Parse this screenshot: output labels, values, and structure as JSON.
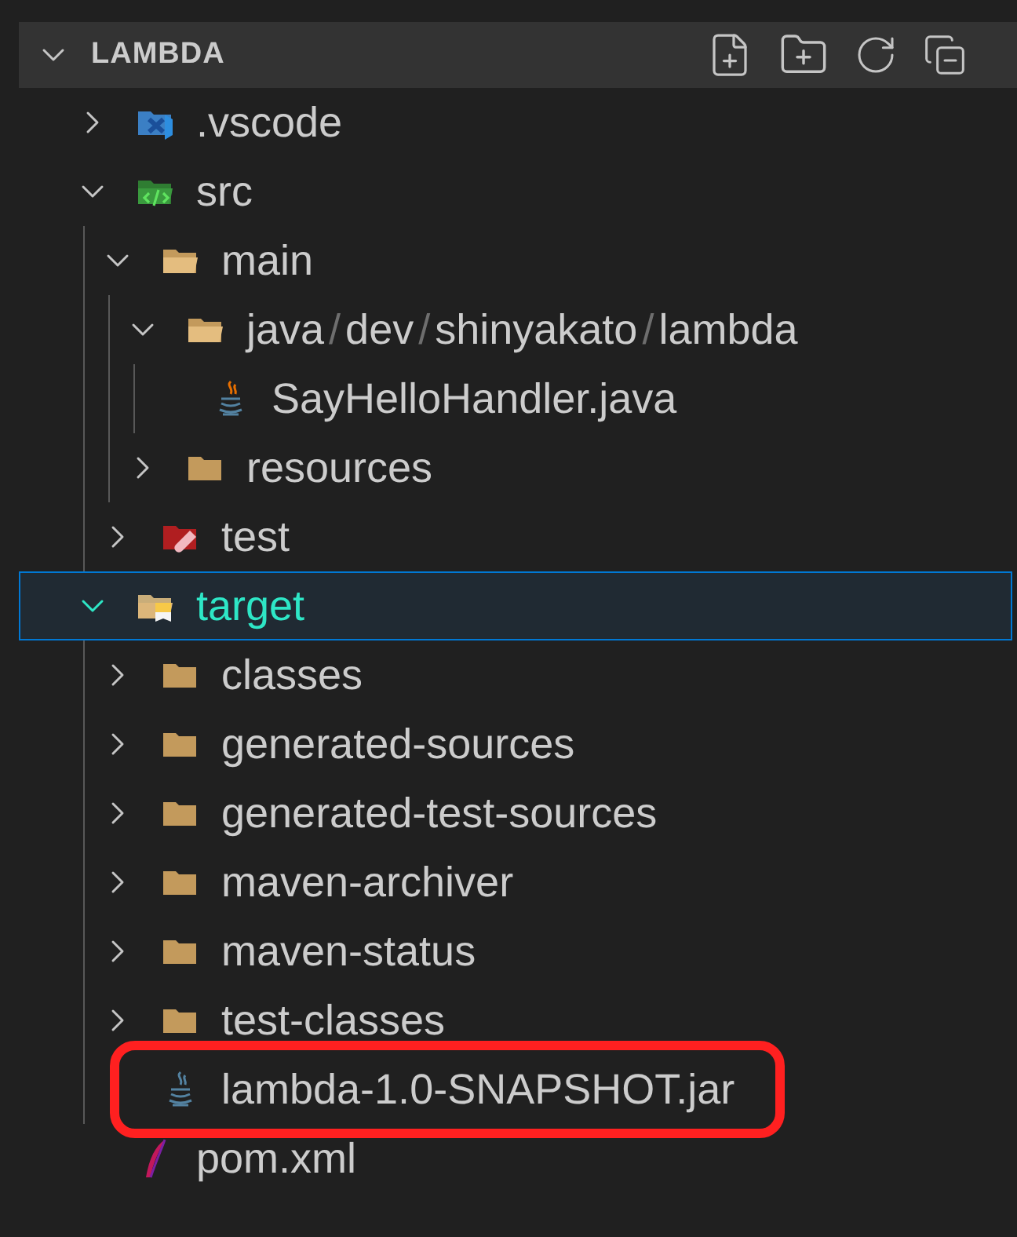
{
  "section": {
    "title": "LAMBDA",
    "expanded": true
  },
  "tree": [
    {
      "name": ".vscode",
      "kind": "vscode",
      "expanded": false,
      "selected": false,
      "highlighted": false
    },
    {
      "name": "src",
      "kind": "source",
      "expanded": true,
      "selected": false,
      "highlighted": false,
      "children": [
        {
          "name": "main",
          "kind": "folder",
          "expanded": true,
          "selected": false,
          "highlighted": false,
          "children": [
            {
              "segments": [
                "java",
                "dev",
                "shinyakato",
                "lambda"
              ],
              "separator": "/",
              "kind": "folder",
              "expanded": true,
              "selected": false,
              "highlighted": false,
              "children": [
                {
                  "name": "SayHelloHandler.java",
                  "kind": "java",
                  "selected": false,
                  "highlighted": false
                }
              ]
            },
            {
              "name": "resources",
              "kind": "folder",
              "expanded": false,
              "selected": false,
              "highlighted": false
            }
          ]
        },
        {
          "name": "test",
          "kind": "tests",
          "expanded": false,
          "selected": false,
          "highlighted": false
        }
      ]
    },
    {
      "name": "target",
      "kind": "target",
      "expanded": true,
      "selected": true,
      "highlighted": false,
      "children": [
        {
          "name": "classes",
          "kind": "folder",
          "expanded": false,
          "selected": false,
          "highlighted": false
        },
        {
          "name": "generated-sources",
          "kind": "folder",
          "expanded": false,
          "selected": false,
          "highlighted": false
        },
        {
          "name": "generated-test-sources",
          "kind": "folder",
          "expanded": false,
          "selected": false,
          "highlighted": false
        },
        {
          "name": "maven-archiver",
          "kind": "folder",
          "expanded": false,
          "selected": false,
          "highlighted": false
        },
        {
          "name": "maven-status",
          "kind": "folder",
          "expanded": false,
          "selected": false,
          "highlighted": false
        },
        {
          "name": "test-classes",
          "kind": "folder",
          "expanded": false,
          "selected": false,
          "highlighted": false
        },
        {
          "name": "lambda-1.0-SNAPSHOT.jar",
          "kind": "jar",
          "selected": false,
          "highlighted": true
        }
      ]
    },
    {
      "name": "pom.xml",
      "kind": "maven",
      "selected": false,
      "highlighted": false
    }
  ]
}
